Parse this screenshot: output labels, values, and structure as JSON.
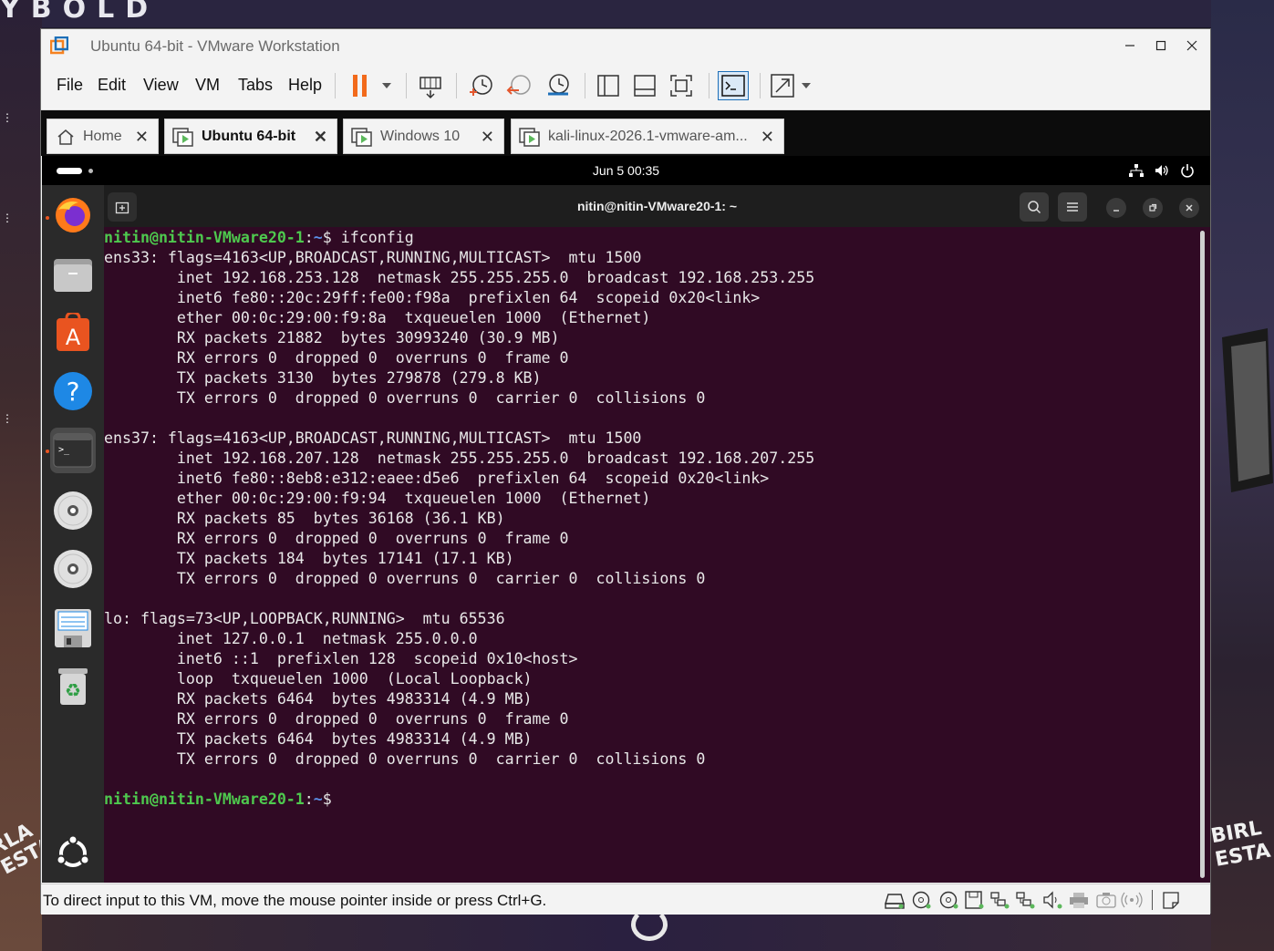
{
  "wallpaper": {
    "top_text": "YBOLD",
    "left_text": "RLA\nESTA",
    "right_text": "BIRL\nESTA"
  },
  "window": {
    "title": "Ubuntu 64-bit - VMware Workstation"
  },
  "menu": [
    "File",
    "Edit",
    "View",
    "VM",
    "Tabs",
    "Help"
  ],
  "tabs": [
    {
      "label": "Home"
    },
    {
      "label": "Ubuntu 64-bit"
    },
    {
      "label": "Windows 10"
    },
    {
      "label": "kali-linux-2026.1-vmware-am..."
    }
  ],
  "guest": {
    "clock": "Jun 5  00:35",
    "terminal_title": "nitin@nitin-VMware20-1: ~",
    "prompt_user": "nitin@nitin-VMware20-1",
    "prompt_sep": ":",
    "prompt_path": "~",
    "prompt_symbol": "$",
    "command": " ifconfig",
    "output": "ens33: flags=4163<UP,BROADCAST,RUNNING,MULTICAST>  mtu 1500\n        inet 192.168.253.128  netmask 255.255.255.0  broadcast 192.168.253.255\n        inet6 fe80::20c:29ff:fe00:f98a  prefixlen 64  scopeid 0x20<link>\n        ether 00:0c:29:00:f9:8a  txqueuelen 1000  (Ethernet)\n        RX packets 21882  bytes 30993240 (30.9 MB)\n        RX errors 0  dropped 0  overruns 0  frame 0\n        TX packets 3130  bytes 279878 (279.8 KB)\n        TX errors 0  dropped 0 overruns 0  carrier 0  collisions 0\n\nens37: flags=4163<UP,BROADCAST,RUNNING,MULTICAST>  mtu 1500\n        inet 192.168.207.128  netmask 255.255.255.0  broadcast 192.168.207.255\n        inet6 fe80::8eb8:e312:eaee:d5e6  prefixlen 64  scopeid 0x20<link>\n        ether 00:0c:29:00:f9:94  txqueuelen 1000  (Ethernet)\n        RX packets 85  bytes 36168 (36.1 KB)\n        RX errors 0  dropped 0  overruns 0  frame 0\n        TX packets 184  bytes 17141 (17.1 KB)\n        TX errors 0  dropped 0 overruns 0  carrier 0  collisions 0\n\nlo: flags=73<UP,LOOPBACK,RUNNING>  mtu 65536\n        inet 127.0.0.1  netmask 255.0.0.0\n        inet6 ::1  prefixlen 128  scopeid 0x10<host>\n        loop  txqueuelen 1000  (Local Loopback)\n        RX packets 6464  bytes 4983314 (4.9 MB)\n        RX errors 0  dropped 0  overruns 0  frame 0\n        TX packets 6464  bytes 4983314 (4.9 MB)\n        TX errors 0  dropped 0 overruns 0  carrier 0  collisions 0\n"
  },
  "status": {
    "text": "To direct input to this VM, move the mouse pointer inside or press Ctrl+G."
  },
  "colors": {
    "terminal_bg": "#300a24",
    "prompt_green": "#4ec94e",
    "prompt_blue": "#5b8fe6",
    "pause_orange": "#f26a1b",
    "accent_green": "#5cb85c"
  }
}
